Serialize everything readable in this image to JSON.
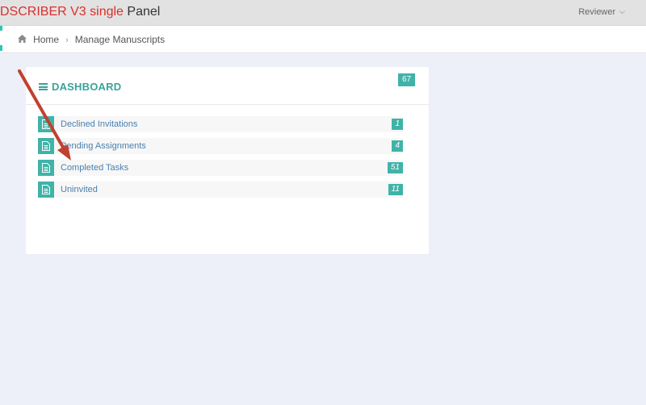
{
  "header": {
    "brand_red": "DSCRIBER V3 single",
    "brand_dark": "Panel",
    "user_label": "Reviewer",
    "user_chevron": "⌄"
  },
  "breadcrumb": {
    "home_icon": "home-icon",
    "home_label": "Home",
    "separator": "›",
    "current_label": "Manage Manuscripts"
  },
  "dashboard": {
    "title": "DASHBOARD",
    "total": "67",
    "items": [
      {
        "label": "Declined Invitations",
        "count": "1"
      },
      {
        "label": "Pending Assignments",
        "count": "4"
      },
      {
        "label": "Completed Tasks",
        "count": "51"
      },
      {
        "label": "Uninvited",
        "count": "11"
      }
    ]
  },
  "colors": {
    "accent": "#40b3a8",
    "brand_red": "#d9302b",
    "link": "#4a7fb0",
    "annotation_arrow": "#c0412f"
  }
}
